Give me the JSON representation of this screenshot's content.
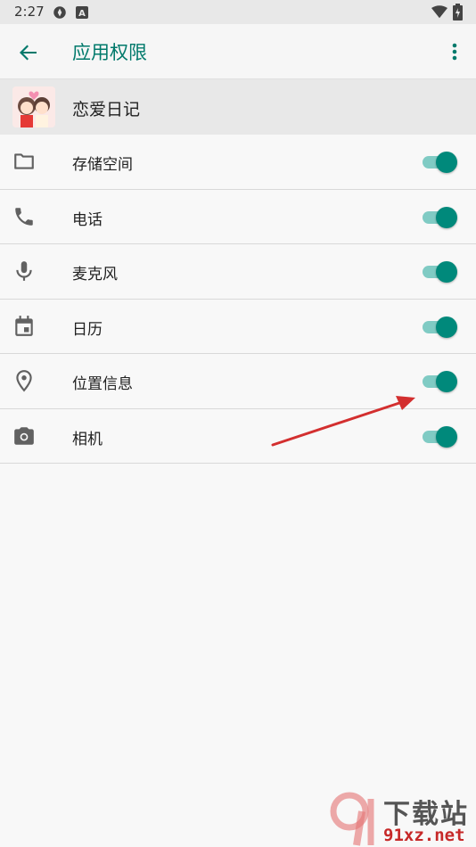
{
  "status_bar": {
    "time": "2:27",
    "icons": [
      "sync-icon",
      "a-icon",
      "wifi-icon",
      "battery-icon"
    ]
  },
  "toolbar": {
    "title": "应用权限",
    "back_icon": "back-arrow-icon",
    "overflow_icon": "more-vert-icon"
  },
  "app": {
    "name": "恋爱日记"
  },
  "permissions": [
    {
      "label": "存储空间",
      "icon": "folder-icon",
      "enabled": true
    },
    {
      "label": "电话",
      "icon": "phone-icon",
      "enabled": true
    },
    {
      "label": "麦克风",
      "icon": "mic-icon",
      "enabled": true
    },
    {
      "label": "日历",
      "icon": "calendar-icon",
      "enabled": true
    },
    {
      "label": "位置信息",
      "icon": "location-icon",
      "enabled": true
    },
    {
      "label": "相机",
      "icon": "camera-icon",
      "enabled": true
    }
  ],
  "colors": {
    "accent": "#00796b",
    "switch_thumb": "#00897b",
    "switch_track": "#80cbc4",
    "annotation_arrow": "#d32f2f"
  },
  "watermark": {
    "title": "下载站",
    "site": "91xz.net"
  }
}
